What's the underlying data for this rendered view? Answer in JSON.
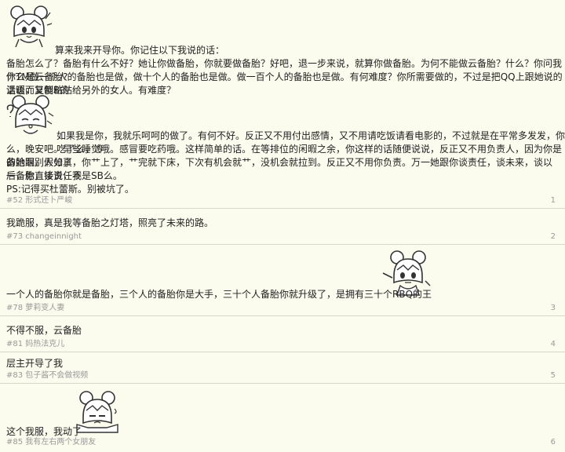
{
  "posts": [
    {
      "lines": [
        "算来我来开导你。你记住以下我说的话：",
        "备胎怎么了？备胎有什么不好？她让你做备胎，你就要做备胎？好吧，退一步来说，就算你做备胎。为何不能做云备胎？什么？你问我什么是云备胎?",
        "你TM做一个人的备胎也是做，做十个人的备胎也是做。做一百个人的备胎也是做。有何难度？你所需要做的，不过是把QQ上跟她说的温暖而又傻B的",
        "话语，复制粘贴给另外的女人。有难度？",
        "如果我是你，我就乐呵呵的做了。有何不好。反正又不用付出感情，又不用请吃饭请看电影的，不过就是在平常多发发，你吃了么，冷",
        "么，晚安吧。早些睡觉哦。感冒要吃药哦。这样简单的话。在等排位的闲暇之余，你这样的话随便说说，反正又不用负责人，因为你是备胎啊。假如真",
        "的她跟别人分了，你艹上了，艹完就下床，下次有机会就艹，没机会就拉到。反正又不用你负责。万一她跟你谈责任，谈未来，谈以后，你直接说，我",
        "一备胎，谈责任不是SB么。",
        "PS:记得买杜蕾斯。别被坑了。"
      ],
      "sticker_caption_1": "",
      "meta": "#52 形式还卜严峻",
      "floor": "1"
    },
    {
      "text": "我跪服，真是我等备胎之灯塔，照亮了未来的路。",
      "meta": "#73 changeinnight",
      "floor": "2"
    },
    {
      "text": "一个人的备胎你就是备胎，三个人的备胎你是大手，三十个人备胎你就升级了，是拥有三十个RBQ的王",
      "meta": "#78 萝莉变人妻",
      "floor": "3"
    },
    {
      "text": "不得不服，云备胎",
      "meta": "#81 妈热法克儿",
      "floor": "4"
    },
    {
      "text": "层主开导了我",
      "meta": "#83 包子酱不会做视频",
      "floor": "5"
    },
    {
      "text": "这个我服，我动了",
      "meta": "#85 我有左右两个女朋友",
      "floor": "6"
    }
  ],
  "stickers": {
    "sticker_1": "anime-girl-sticker",
    "sticker_2": "anime-girl-thinking-sticker",
    "sticker_3": "anime-girl-pointing-sticker",
    "sticker_4": "anime-girl-sweat-sticker"
  }
}
